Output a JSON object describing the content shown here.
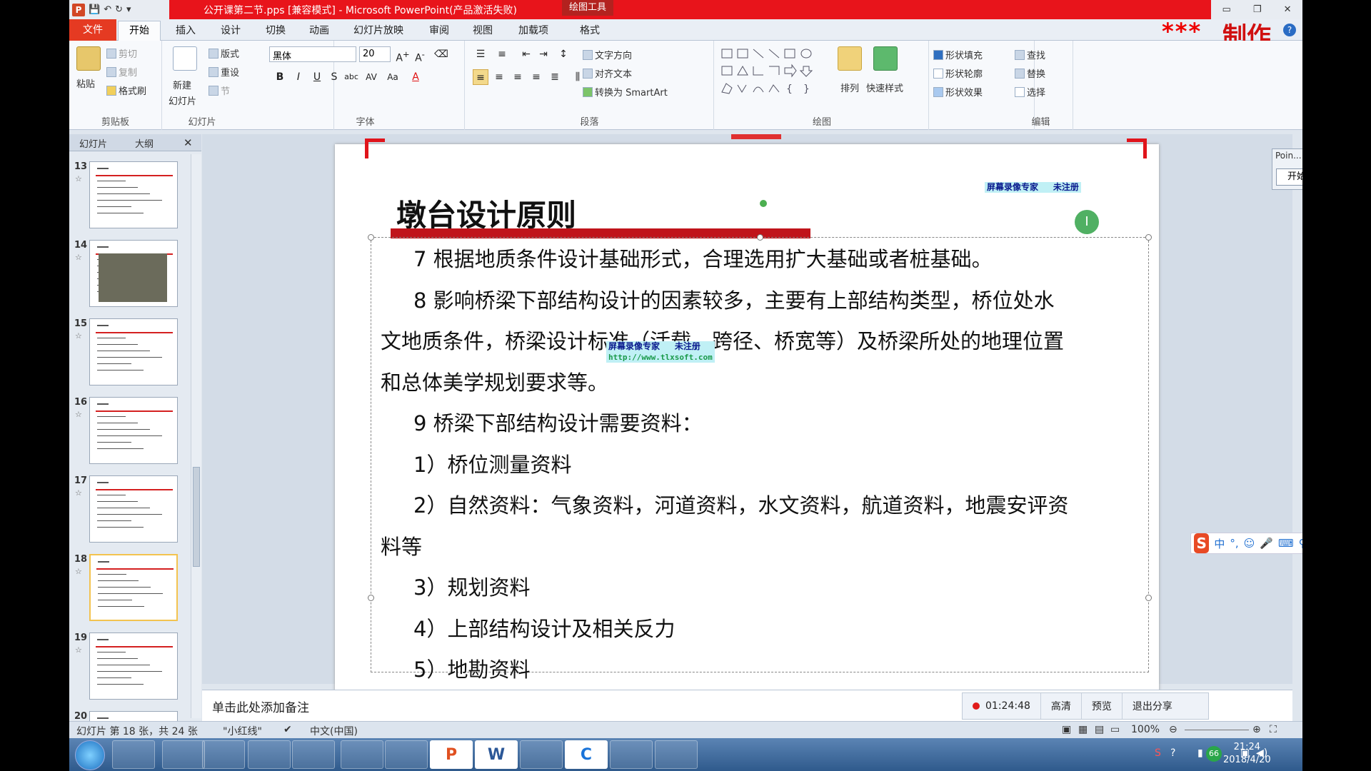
{
  "window": {
    "title": "公开课第二节.pps [兼容模式] - Microsoft PowerPoint(产品激活失败)",
    "context_tab": "绘图工具",
    "controls": [
      "▭",
      "❐",
      "✕"
    ]
  },
  "watermark_brand": {
    "stars": "***",
    "text": "制作"
  },
  "tabs": {
    "file": "文件",
    "home": "开始",
    "insert": "插入",
    "design": "设计",
    "transitions": "切换",
    "animations": "动画",
    "slideshow": "幻灯片放映",
    "review": "审阅",
    "view": "视图",
    "addins": "加载项",
    "format": "格式"
  },
  "ribbon": {
    "clipboard": {
      "label": "剪贴板",
      "paste": "粘贴",
      "cut": "剪切",
      "copy": "复制",
      "format_painter": "格式刷"
    },
    "slides": {
      "label": "幻灯片",
      "new_slide": "新建",
      "new_slide2": "幻灯片",
      "layout": "版式",
      "reset": "重设",
      "section": "节"
    },
    "font": {
      "label": "字体",
      "font_name": "黑体",
      "font_size": "20"
    },
    "paragraph": {
      "label": "段落",
      "text_direction": "文字方向",
      "align_text": "对齐文本",
      "smartart": "转换为 SmartArt"
    },
    "drawing": {
      "label": "绘图",
      "arrange": "排列",
      "quick_styles": "快速样式",
      "shape_fill": "形状填充",
      "shape_outline": "形状轮廓",
      "shape_effects": "形状效果"
    },
    "editing": {
      "label": "编辑",
      "find": "查找",
      "replace": "替换",
      "select": "选择"
    }
  },
  "left_panel": {
    "tab_slides": "幻灯片",
    "tab_outline": "大纲",
    "thumbnails": [
      {
        "num": "13"
      },
      {
        "num": "14"
      },
      {
        "num": "15"
      },
      {
        "num": "16"
      },
      {
        "num": "17"
      },
      {
        "num": "18"
      },
      {
        "num": "19"
      },
      {
        "num": "20"
      }
    ],
    "selected": "18"
  },
  "slide": {
    "title": "墩台设计原则",
    "lines": [
      "7 根据地质条件设计基础形式，合理选用扩大基础或者桩基础。",
      "8 影响桥梁下部结构设计的因素较多，主要有上部结构类型，桥位处水",
      "文地质条件，桥梁设计标准（活载、跨径、桥宽等）及桥梁所处的地理位置",
      "和总体美学规划要求等。",
      "9 桥梁下部结构设计需要资料：",
      "1）桥位测量资料",
      "2）自然资料：气象资料，河道资料，水文资料，航道资料，地震安评资",
      "料等",
      "3）规划资料",
      "4）上部结构设计及相关反力",
      "5）地勘资料"
    ],
    "watermark": {
      "name": "屏幕录像专家",
      "status": "未注册",
      "url": "http://www.tlxsoft.com"
    }
  },
  "pointer_window": {
    "title": "Poin...",
    "start": "开始"
  },
  "ime": {
    "logo": "S",
    "items": [
      "中",
      "°,",
      "☺",
      "🎤",
      "⌨",
      "⚲",
      "👕",
      "🔧"
    ]
  },
  "notes": {
    "placeholder": "单击此处添加备注"
  },
  "recorder": {
    "time": "01:24:48",
    "hd": "高清",
    "preview": "预览",
    "exit_share": "退出分享"
  },
  "status": {
    "slide_info": "幻灯片 第 18 张，共 24 张",
    "theme": "\"小红线\"",
    "language": "中文(中国)",
    "zoom": "100%"
  },
  "taskbar": {
    "apps": [
      "",
      "",
      "",
      "",
      "",
      "",
      "P",
      "W",
      "",
      "C",
      "",
      ""
    ],
    "time": "21:24",
    "date": "2018/4/20",
    "battery": "66"
  }
}
